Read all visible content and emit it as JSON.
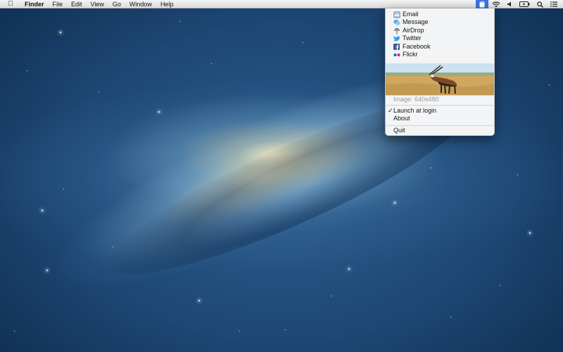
{
  "menubar": {
    "items": [
      {
        "label": "Finder",
        "bold": true
      },
      {
        "label": "File"
      },
      {
        "label": "Edit"
      },
      {
        "label": "View"
      },
      {
        "label": "Go"
      },
      {
        "label": "Window"
      },
      {
        "label": "Help"
      }
    ],
    "status_icons": [
      "clipboard-share-icon",
      "wifi-icon",
      "volume-icon",
      "battery-icon",
      "search-icon",
      "notification-list-icon"
    ],
    "active_color": "#3f6fe3"
  },
  "share_menu": {
    "items": [
      {
        "label": "Email",
        "icon": "email-icon"
      },
      {
        "label": "Message",
        "icon": "message-icon"
      },
      {
        "label": "AirDrop",
        "icon": "airdrop-icon"
      },
      {
        "label": "Twitter",
        "icon": "twitter-icon"
      },
      {
        "label": "Facebook",
        "icon": "facebook-icon"
      },
      {
        "label": "Flickr",
        "icon": "flickr-icon"
      }
    ],
    "image_caption": "Image: 640x480",
    "launch_at_login": "Launch at login",
    "launch_checked": true,
    "check_mark": "✓",
    "about": "About",
    "quit": "Quit"
  },
  "colors": {
    "twitter": "#3a9fe4",
    "facebook": "#3b5998",
    "flickr_pink": "#ff0084",
    "flickr_blue": "#0063dc"
  }
}
